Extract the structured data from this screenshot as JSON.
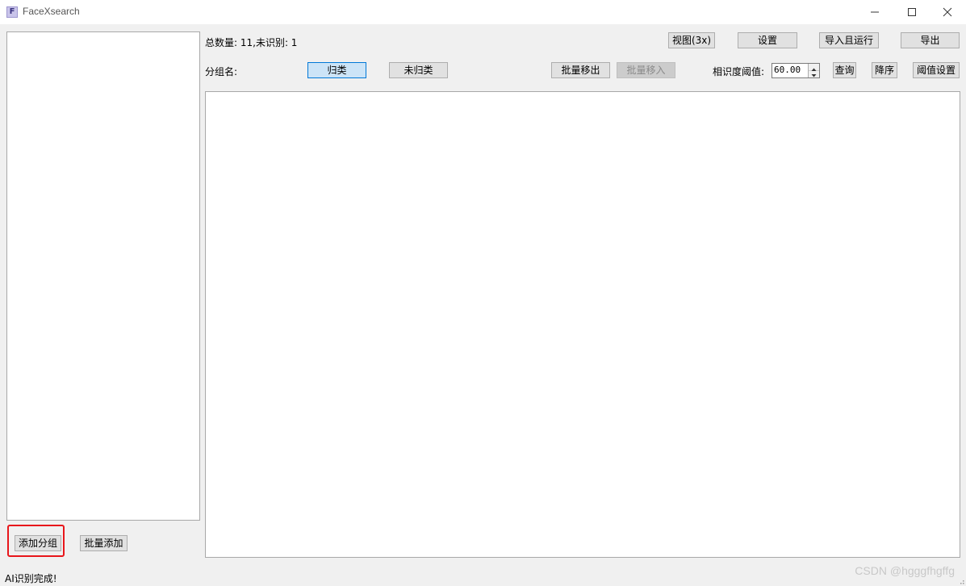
{
  "window": {
    "title": "FaceXsearch",
    "app_icon_letter": "F",
    "controls": [
      "minimize-icon",
      "maximize-icon",
      "close-icon"
    ]
  },
  "summary": {
    "text": "总数量: 11,未识别: 1"
  },
  "toolbar": {
    "view_label": "视图(3x)",
    "settings_label": "设置",
    "import_run_label": "导入且运行",
    "export_label": "导出"
  },
  "group": {
    "label": "分组名:",
    "classified_label": "归类",
    "unclassified_label": "未归类",
    "batch_move_out_label": "批量移出",
    "batch_move_in_label": "批量移入"
  },
  "similarity": {
    "label": "相识度阈值:",
    "value": "60.00",
    "query_label": "查询",
    "sort_desc_label": "降序",
    "threshold_settings_label": "阈值设置"
  },
  "left_panel": {
    "add_group_label": "添加分组",
    "batch_add_label": "批量添加"
  },
  "status": {
    "text": "AI识别完成!"
  },
  "watermark": {
    "text": "CSDN @hgggfhgffg"
  },
  "colors": {
    "selected_bg": "#cce4f7",
    "selected_border": "#0078d7",
    "highlight_border": "#e8161b",
    "window_bg": "#f0f0f0"
  }
}
